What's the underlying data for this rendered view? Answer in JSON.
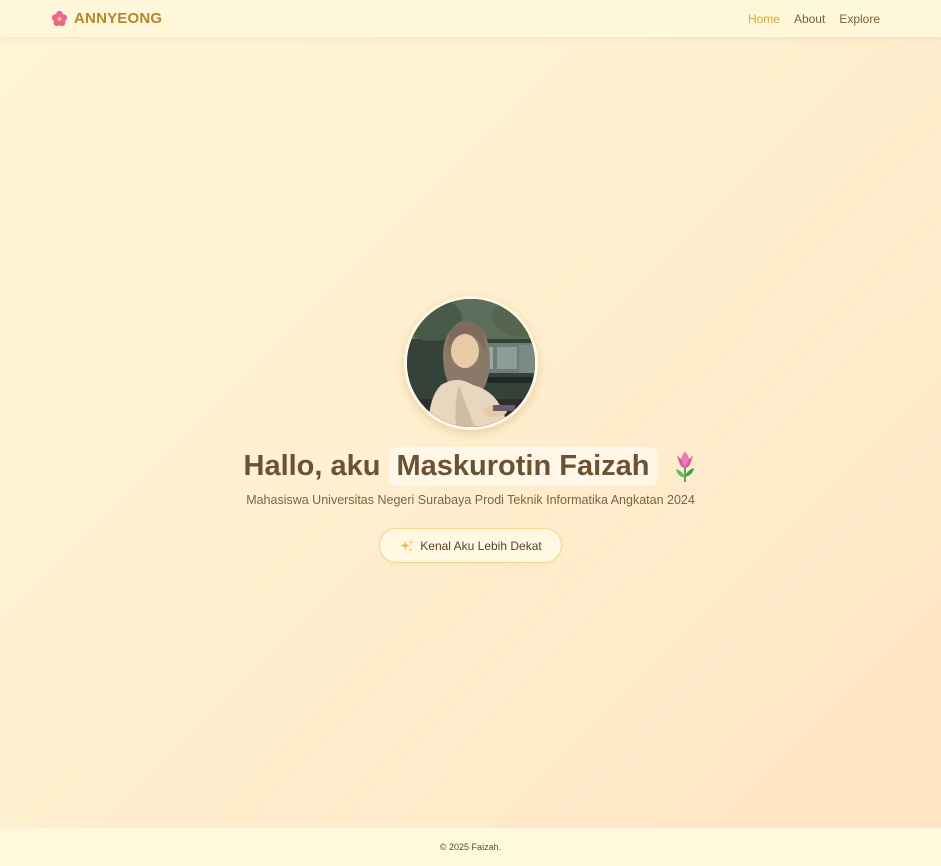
{
  "nav": {
    "brand": "ANNYEONG",
    "brand_icon": "flower-icon",
    "links": [
      {
        "label": "Home",
        "active": true
      },
      {
        "label": "About",
        "active": false
      },
      {
        "label": "Explore",
        "active": false
      }
    ]
  },
  "hero": {
    "avatar_icon": "profile-photo",
    "greeting": "Hallo, aku",
    "name": "Maskurotin Faizah",
    "title_icon": "tulip-icon",
    "subtitle": "Mahasiswa Universitas Negeri Surabaya Prodi Teknik Informatika Angkatan 2024",
    "cta_icon": "sparkles-icon",
    "cta_label": "Kenal Aku Lebih Dekat"
  },
  "footer": {
    "text": "© 2025 Faizah."
  },
  "colors": {
    "brand": "#b5862a",
    "nav_active": "#d4a93a",
    "title": "#6a5232",
    "cta_border": "#f1d98c"
  }
}
